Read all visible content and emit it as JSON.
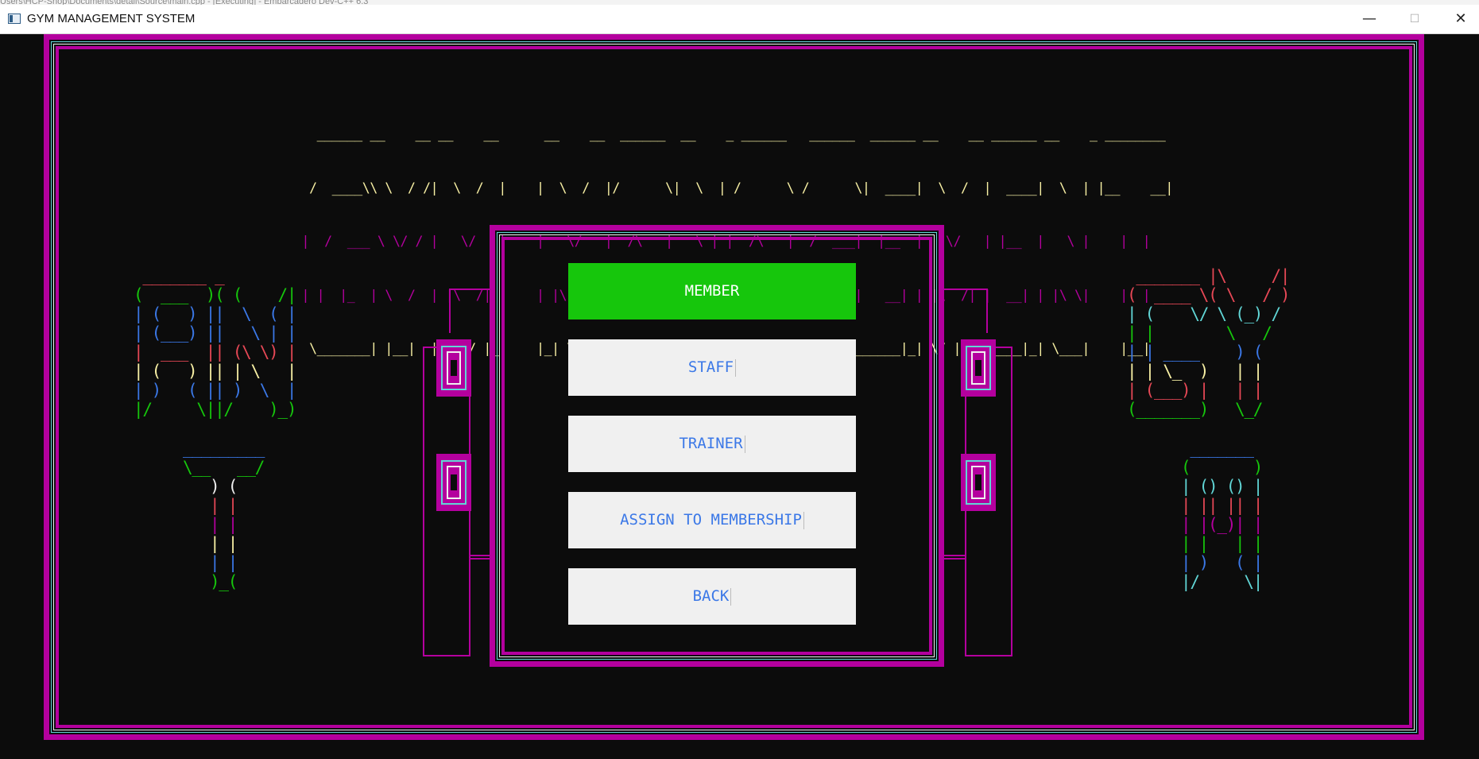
{
  "window": {
    "behind_text": "Users\\HCP-Shop\\Documents\\detail\\Source\\main.cpp - [Executing] - Embarcadero Dev-C++ 6.3",
    "title": "GYM MANAGEMENT SYSTEM",
    "controls": {
      "minimize": "—",
      "maximize": "☐",
      "close": "✕"
    }
  },
  "banner": {
    "line_colors": [
      "#f9f1a5",
      "#f9f1a5",
      "#b4009e",
      "#b4009e",
      "#f9f1a5"
    ],
    "lines": [
      "   ______ __    __ __    __      __    __  ______  __    _ ______   ______  ______ __    __ ______ __    _ ________",
      "  /  ____\\\\ \\  / /|  \\  /  |    |  \\  /  |/      \\|  \\  | /      \\ /      \\|  ____|  \\  /  |  ____|  \\  | |__    __|",
      " |  /  ___ \\ \\/ / |   \\/   |    |   \\/   |  /\\   |   \\ | |  /\\   |  /  ___|  |__  |   \\/   | |__  |   \\ |    |  |",
      " | |  |_  | \\  /  | |\\  /| |    | |\\  /| | /__\\  | |\\ \\| | /__\\  | |  |_  |   __| | |\\  /| |  __| | |\\ \\|    |  |",
      "  \\_______| |__|  |_| \\/ |_|    |_| \\/ |_|/    \\_|_| \\___|/    \\_|\\______|______|_| \\/ |_|______|_| \\___|    |__|"
    ]
  },
  "art": {
    "left_top": {
      "lines": [
        " _______ _",
        "(  ___  )( (    /|",
        "| (   ) ||  \\  ( |",
        "| (___) ||   \\ | |",
        "|  ___  || (\\ \\) |",
        "| (   ) || | \\   |",
        "| )   ( || )  \\  |",
        "|/     \\||/    )_)"
      ],
      "colors": [
        "#e74856",
        "#16c60c",
        "#3b78e7",
        "#3b78e7",
        "#e74856",
        "#f9f1a5",
        "#3b78e7",
        "#16c60c"
      ]
    },
    "left_bottom": {
      "lines": [
        "_________",
        "\\__   __/",
        "   ) (",
        "   | |",
        "   | |",
        "   | |",
        "   | |",
        "   )_("
      ],
      "colors": [
        "#3b78e7",
        "#16c60c",
        "#f0f0f0",
        "#e74856",
        "#b4009e",
        "#f9f1a5",
        "#3b78e7",
        "#16c60c"
      ]
    },
    "right_top": {
      "lines": [
        " _______ |\\     /|",
        "(  ____ \\( \\   / )",
        "| (    \\/ \\ (_) /",
        "| |        \\   /",
        "| | ____    ) (",
        "| | \\_  )   | |",
        "| (___) |   | |",
        "(_______)   \\_/"
      ],
      "colors": [
        "#e74856",
        "#e74856",
        "#61d6d6",
        "#16c60c",
        "#3b78e7",
        "#f9f1a5",
        "#e74856",
        "#16c60c"
      ]
    },
    "right_bottom": {
      "lines": [
        " _______",
        "(       )",
        "| () () |",
        "| || || |",
        "| |(_)| |",
        "| |   | |",
        "| )   ( |",
        "|/     \\|"
      ],
      "colors": [
        "#3b78e7",
        "#16c60c",
        "#61d6d6",
        "#e74856",
        "#b4009e",
        "#16c60c",
        "#3b78e7",
        "#61d6d6"
      ]
    }
  },
  "menu": {
    "items": [
      {
        "label": "MEMBER",
        "active": true
      },
      {
        "label": "STAFF",
        "active": false
      },
      {
        "label": "TRAINER",
        "active": false
      },
      {
        "label": "ASSIGN TO MEMBERSHIP",
        "active": false
      },
      {
        "label": "BACK",
        "active": false
      }
    ]
  },
  "colors": {
    "border_magenta": "#b4009e",
    "border_cyan": "#61d6d6",
    "selected_green": "#16c60c",
    "button_text_blue": "#3b78e7",
    "button_bg": "#f0f0f0",
    "console_bg": "#0c0c0c"
  }
}
